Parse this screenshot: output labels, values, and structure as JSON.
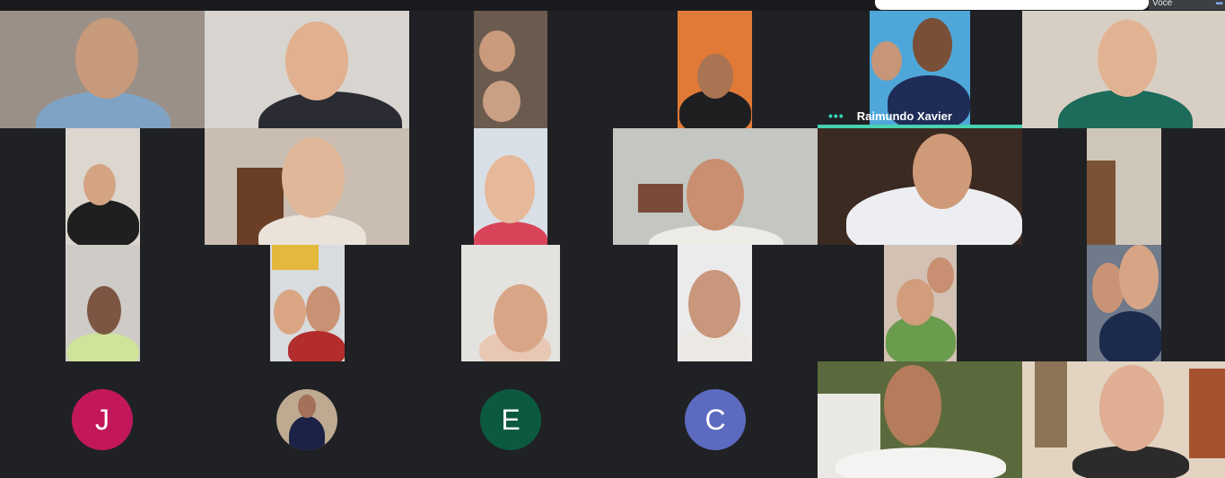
{
  "meeting": {
    "self_view": {
      "label": "Você"
    },
    "active_speaker": {
      "name": "Raimundo Xavier",
      "more_icon": "more-dots-icon"
    },
    "colors": {
      "background": "#202124",
      "speaking_indicator": "#47d3b2",
      "avatar_j": "#c2185b",
      "avatar_e": "#0b5a3f",
      "avatar_c": "#5c6bc0"
    },
    "avatars": [
      {
        "letter": "J"
      },
      {
        "letter": ""
      },
      {
        "letter": "E"
      },
      {
        "letter": "C"
      }
    ]
  }
}
